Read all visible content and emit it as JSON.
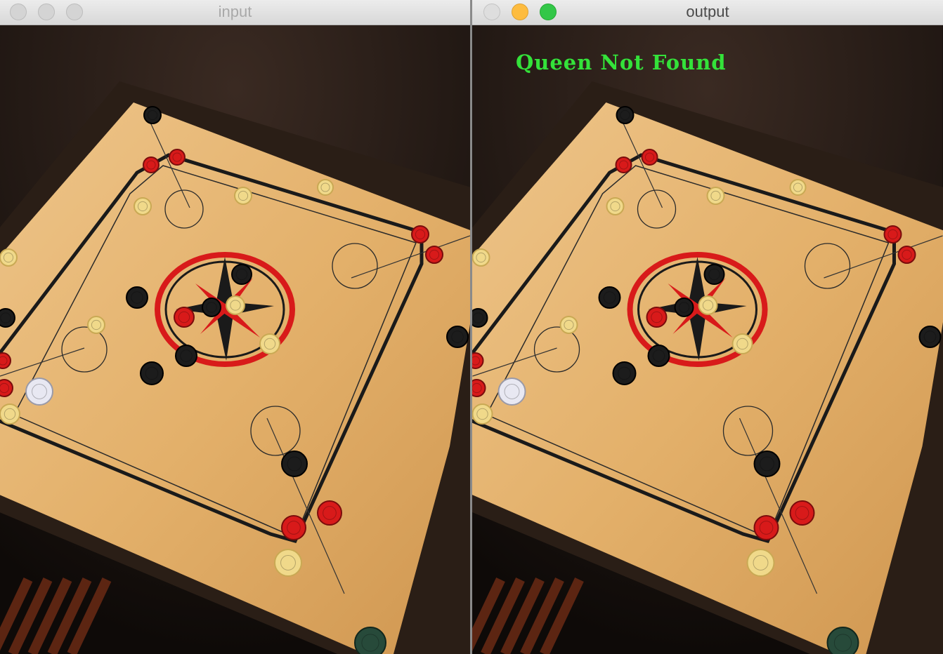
{
  "windows": {
    "input": {
      "title": "input"
    },
    "output": {
      "title": "output",
      "overlay_text": "Queen Not Found"
    }
  },
  "colors": {
    "board": "#e3b06a",
    "frame": "#2a1e16",
    "red_coin": "#d81a1a",
    "black_coin": "#1c1c1c",
    "white_coin": "#f0d98a",
    "overlay_text": "#34e23a"
  },
  "icons": [
    "close-button",
    "minimize-button",
    "maximize-button"
  ]
}
